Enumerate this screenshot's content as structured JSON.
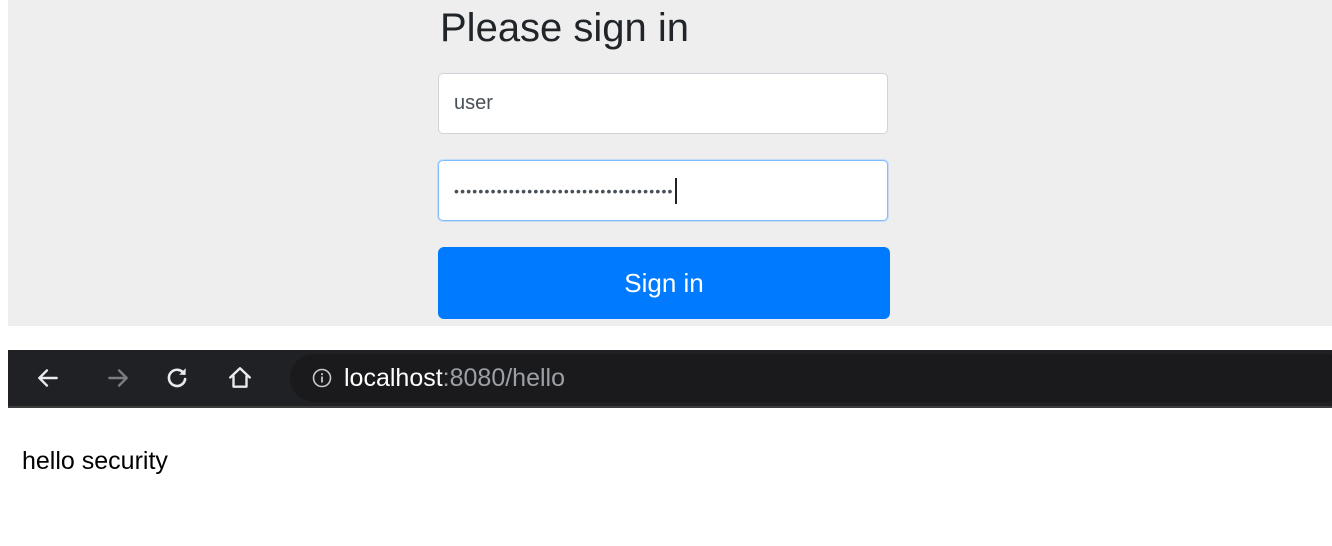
{
  "login": {
    "heading": "Please sign in",
    "username_value": "user",
    "password_dots": "••••••••••••••••••••••••••••••••••••",
    "signin_label": "Sign in",
    "button_color": "#007bff",
    "focus_border_color": "#80bdff"
  },
  "browser": {
    "back_icon": "arrow-left-icon",
    "forward_icon": "arrow-right-icon",
    "reload_icon": "reload-icon",
    "home_icon": "home-icon",
    "info_icon": "info-icon",
    "url_host": "localhost",
    "url_rest": ":8080/hello"
  },
  "page": {
    "body_text": "hello security"
  }
}
